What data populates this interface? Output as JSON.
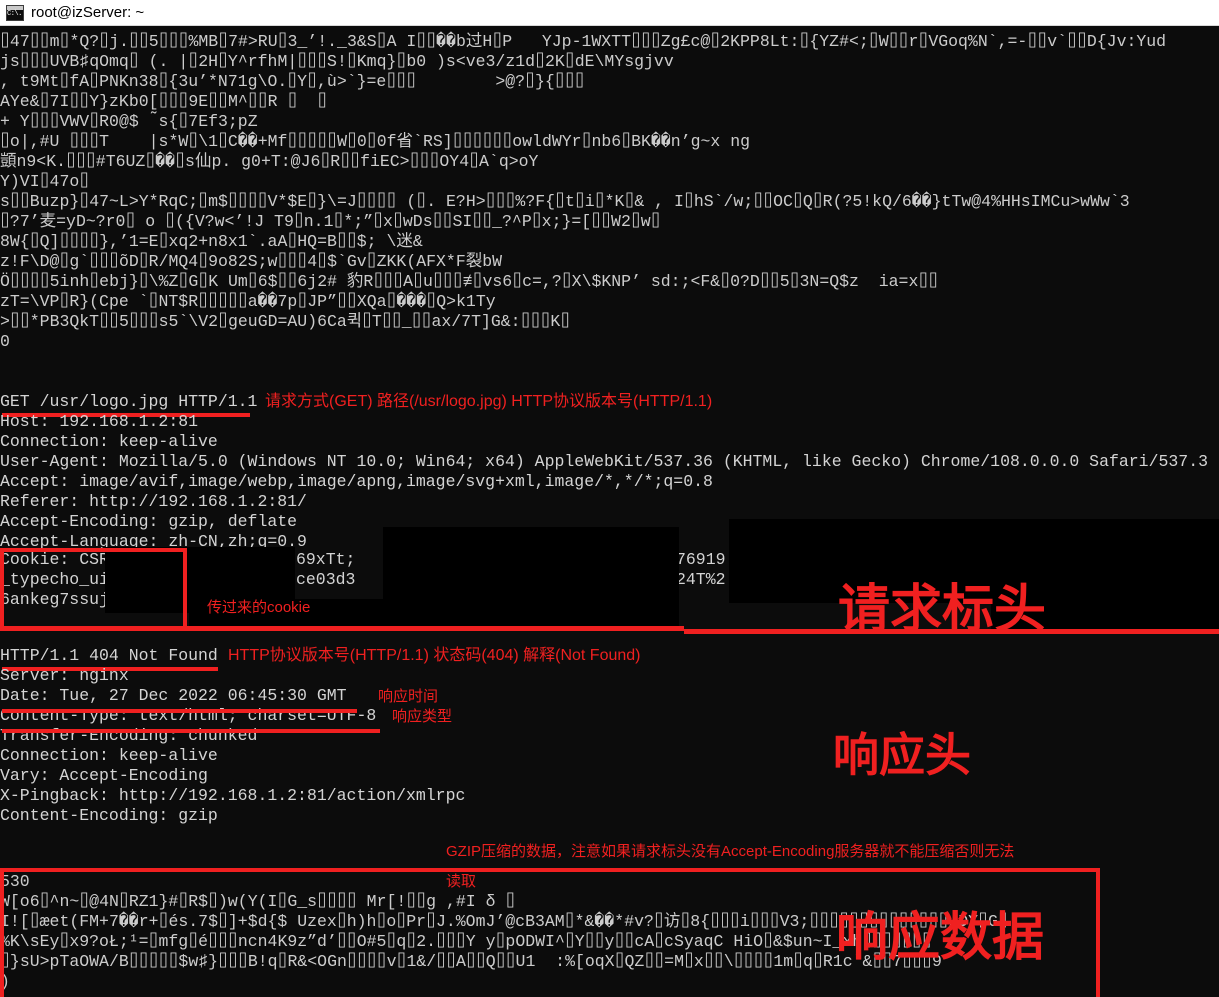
{
  "window": {
    "title": "root@izServer: ~",
    "icon": "cmd-terminal-icon",
    "icon_text": "C:\\."
  },
  "colors": {
    "terminal_bg": "#0c0c0c",
    "terminal_fg": "#cccccc",
    "annotation_red": "#f02020",
    "titlebar_bg": "#ffffff",
    "titlebar_fg": "#000000"
  },
  "terminal": {
    "binary_top": [
      "⌷47⌷⌷m⌷*Q?⌷j.⌷⌷5⌷⌷⌷%MB⌷7#>RU⌷3_’!._3&S⌷A I⌷⌷��b过H⌷P   YJp-1WXTT⌷⌷⌷Zg£c@⌷2KPP8Lt:⌷{YZ#<;⌷W⌷⌷r⌷VGoq%N`,=-⌷⌷v`⌷⌷D{Jv:Yud",
      "js⌷⌷⌷UVB♯qOmq⌷ (. |⌷2H⌷Y^rfhM|⌷⌷⌷S!⌷Kmq}⌷b0 )s<ve3/z1d⌷2K⌷dE\\MYsgjvv",
      ", t9Mt⌷fA⌷PNKn38⌷{3u’*N71g\\O.⌷Y⌷,ù>`}=e⌷⌷⌷        >@?⌷}{⌷⌷⌷",
      "AYe&⌷7I⌷⌷Y}zKb0[⌷⌷⌷9E⌷⌷M^⌷⌷R ⌷  ⌷",
      "+ Y⌷⌷⌷VWV⌷R0@$  ̃s{⌷7Ef3;pZ",
      "⌷o|,#U ⌷⌷⌷T    |s*W⌷\\1⌷C��+Mf⌷⌷⌷⌷⌷W⌷0⌷0f省`RS]⌷⌷⌷⌷⌷⌷owldWYr⌷nb6⌷BK��n’g~x ng",
      "顗n9<K.⌷⌷⌷#T6UZ⌷��⌷s仙p. g0+T:@J6⌷R⌷⌷fiEC>⌷⌷⌷OY4⌷A`q>oY",
      "Y)VI⌷47o⌷",
      "s⌷⌷Buzp}⌷47~L>Y*RqC;⌷m$⌷⌷⌷⌷V*$E⌷}\\=J⌷⌷⌷⌷ (⌷. E?H>⌷⌷⌷%?F{⌷t⌷i⌷*K⌷& , I⌷hS`/w;⌷⌷OC⌷Q⌷R(?5!kQ/6��}tTw@4%HHsIMCu>wWw`3",
      "⌷?7’麦=yD~?r0⌷ o ⌷({V?w<’!J T9⌷n.1⌷*;”⌷x⌷wDs⌷⌷SI⌷⌷_?^P⌷x;}=[⌷⌷W2⌷w⌷",
      "8W{⌷Q]⌷⌷⌷⌷},’1=E⌷xq2+n8x1`.aA⌷HQ=B⌷⌷$; \\迷&",
      "z!F\\D@⌷g`⌷⌷⌷õD⌷R/MQ4⌷9o82S;w⌷⌷⌷4⌷$`Gv⌷ZKK(AFX*F裂bW",
      "Ö⌷⌷⌷⌷5inh⌷ebj}⌷\\%Z⌷G⌷K Um⌷6$⌷⌷6j2# 豹R⌷⌷⌷A⌷u⌷⌷⌷≢⌷vs6⌷c=,?⌷X\\$KNP’ sd:;<F&⌷0?D⌷⌷5⌷3N=Q$z  ia=x⌷⌷",
      "zT=\\VP⌷R}(Cpe `⌷NT$R⌷⌷⌷⌷⌷a��7p⌷JP”⌷⌷XQa⌷���⌷Q>k1Ty",
      ">⌷⌷*PB3QkT⌷⌷5⌷⌷⌷s5`\\V2⌷geuGD=AU)6Ca퀵⌷T⌷⌷_⌷⌷ax/7T]G&:⌷⌷⌷K⌷",
      "0"
    ],
    "request": {
      "request_line": "GET /usr/logo.jpg HTTP/1.1",
      "headers": [
        "Host: 192.168.1.2:81",
        "Connection: keep-alive",
        "User-Agent: Mozilla/5.0 (Windows NT 10.0; Win64; x64) AppleWebKit/537.36 (KHTML, like Gecko) Chrome/108.0.0.0 Safari/537.3",
        "Accept: image/avif,image/webp,image/apng,image/svg+xml,image/*,*/*;q=0.8",
        "Referer: http://192.168.1.2:81/",
        "Accept-Encoding: gzip, deflate",
        "Accept-Language: zh-CN,zh;q=0.9"
      ],
      "cookie_lines": [
        "Cookie: CSR",
        "_typecho_ui",
        "6ankeg7ssuj"
      ],
      "cookie_fragments": [
        "69xTt;",
        "ce03d3",
        "76919",
        "24T%2"
      ]
    },
    "response": {
      "status_line": "HTTP/1.1 404 Not Found",
      "headers": [
        "Server: nginx",
        "Date: Tue, 27 Dec 2022 06:45:30 GMT",
        "Content-Type: text/html; charset=UTF-8",
        "Transfer-Encoding: chunked",
        "Connection: keep-alive",
        "Vary: Accept-Encoding",
        "X-Pingback: http://192.168.1.2:81/action/xmlrpc",
        "Content-Encoding: gzip"
      ],
      "body_lines": [
        "530",
        "W[o6⌷^n~⌷@4N⌷RZ1}#⌷R$⌷)w(Y(I⌷G_s⌷⌷⌷⌷ Mr[!⌷⌷g ,#I δ ⌷",
        "I![⌷æet(FM+7��r+⌷és.7$⌷]+$d{$ Uzex⌷h)h⌷o⌷Pr⌷J.%OmJ’@cB3AM⌷*&��*#v?⌷访⌷8{⌷⌷⌷i⌷⌷⌷V3;⌷⌷⌷⌷⌷⌷⌷⌷⌷⌷⌷⌷⌷⌷/DY⌷G⌷",
        "%K\\sEy⌷x9?oŁ;¹=⌷mfg⌷é⌷⌷⌷ncn4K9z”d’⌷⌷O#5⌷q⌷2.⌷⌷⌷Y y⌷pODWI^⌷Y⌷⌷y⌷⌷cA⌷cSyaqC HiO⌷&$un~I_xh⌷⌷⌷⌷⌷⌷⌷",
        "⌷}sU>pTaOWA/B⌷⌷⌷⌷⌷$w♯}⌷⌷⌷B!q⌷R&<OGn⌷⌷⌷⌷v⌷1&/⌷⌷A⌷⌷Q⌷⌷U1  :%[oqX⌷QZ⌷⌷=M⌷x⌷⌷\\⌷⌷⌷⌷1m⌷q⌷R1c`&⌷⌷7⌷⌷⌷9",
        ")"
      ]
    }
  },
  "annotations": {
    "request_line_note": "请求方式(GET) 路径(/usr/logo.jpg) HTTP协议版本号(HTTP/1.1)",
    "cookie_note": "传过来的cookie",
    "request_headers_label": "请求标头",
    "status_line_note": "HTTP协议版本号(HTTP/1.1) 状态码(404) 解释(Not Found)",
    "date_note": "响应时间",
    "content_type_note": "响应类型",
    "response_headers_label": "响应头",
    "gzip_note_line1": "GZIP压缩的数据，注意如果请求标头没有Accept-Encoding服务器就不能压缩否则无法",
    "gzip_note_line2": "读取",
    "response_body_label": "响应数据"
  }
}
